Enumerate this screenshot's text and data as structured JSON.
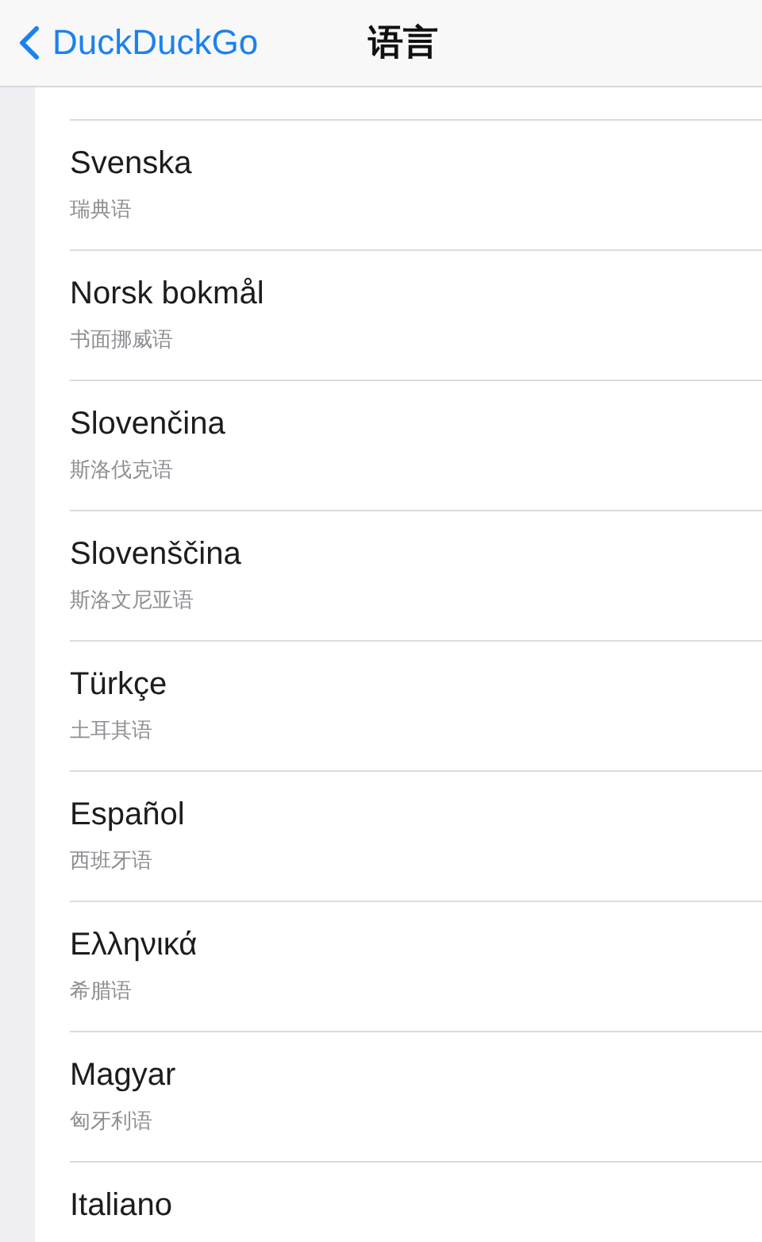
{
  "nav": {
    "back": "DuckDuckGo",
    "title": "语言"
  },
  "languages": [
    {
      "name": "Svenska",
      "translation": "瑞典语"
    },
    {
      "name": "Norsk bokmål",
      "translation": "书面挪威语"
    },
    {
      "name": "Slovenčina",
      "translation": "斯洛伐克语"
    },
    {
      "name": "Slovenščina",
      "translation": "斯洛文尼亚语"
    },
    {
      "name": "Türkçe",
      "translation": "土耳其语"
    },
    {
      "name": "Español",
      "translation": "西班牙语"
    },
    {
      "name": "Ελληνικά",
      "translation": "希腊语"
    },
    {
      "name": "Magyar",
      "translation": "匈牙利语"
    },
    {
      "name": "Italiano"
    }
  ]
}
